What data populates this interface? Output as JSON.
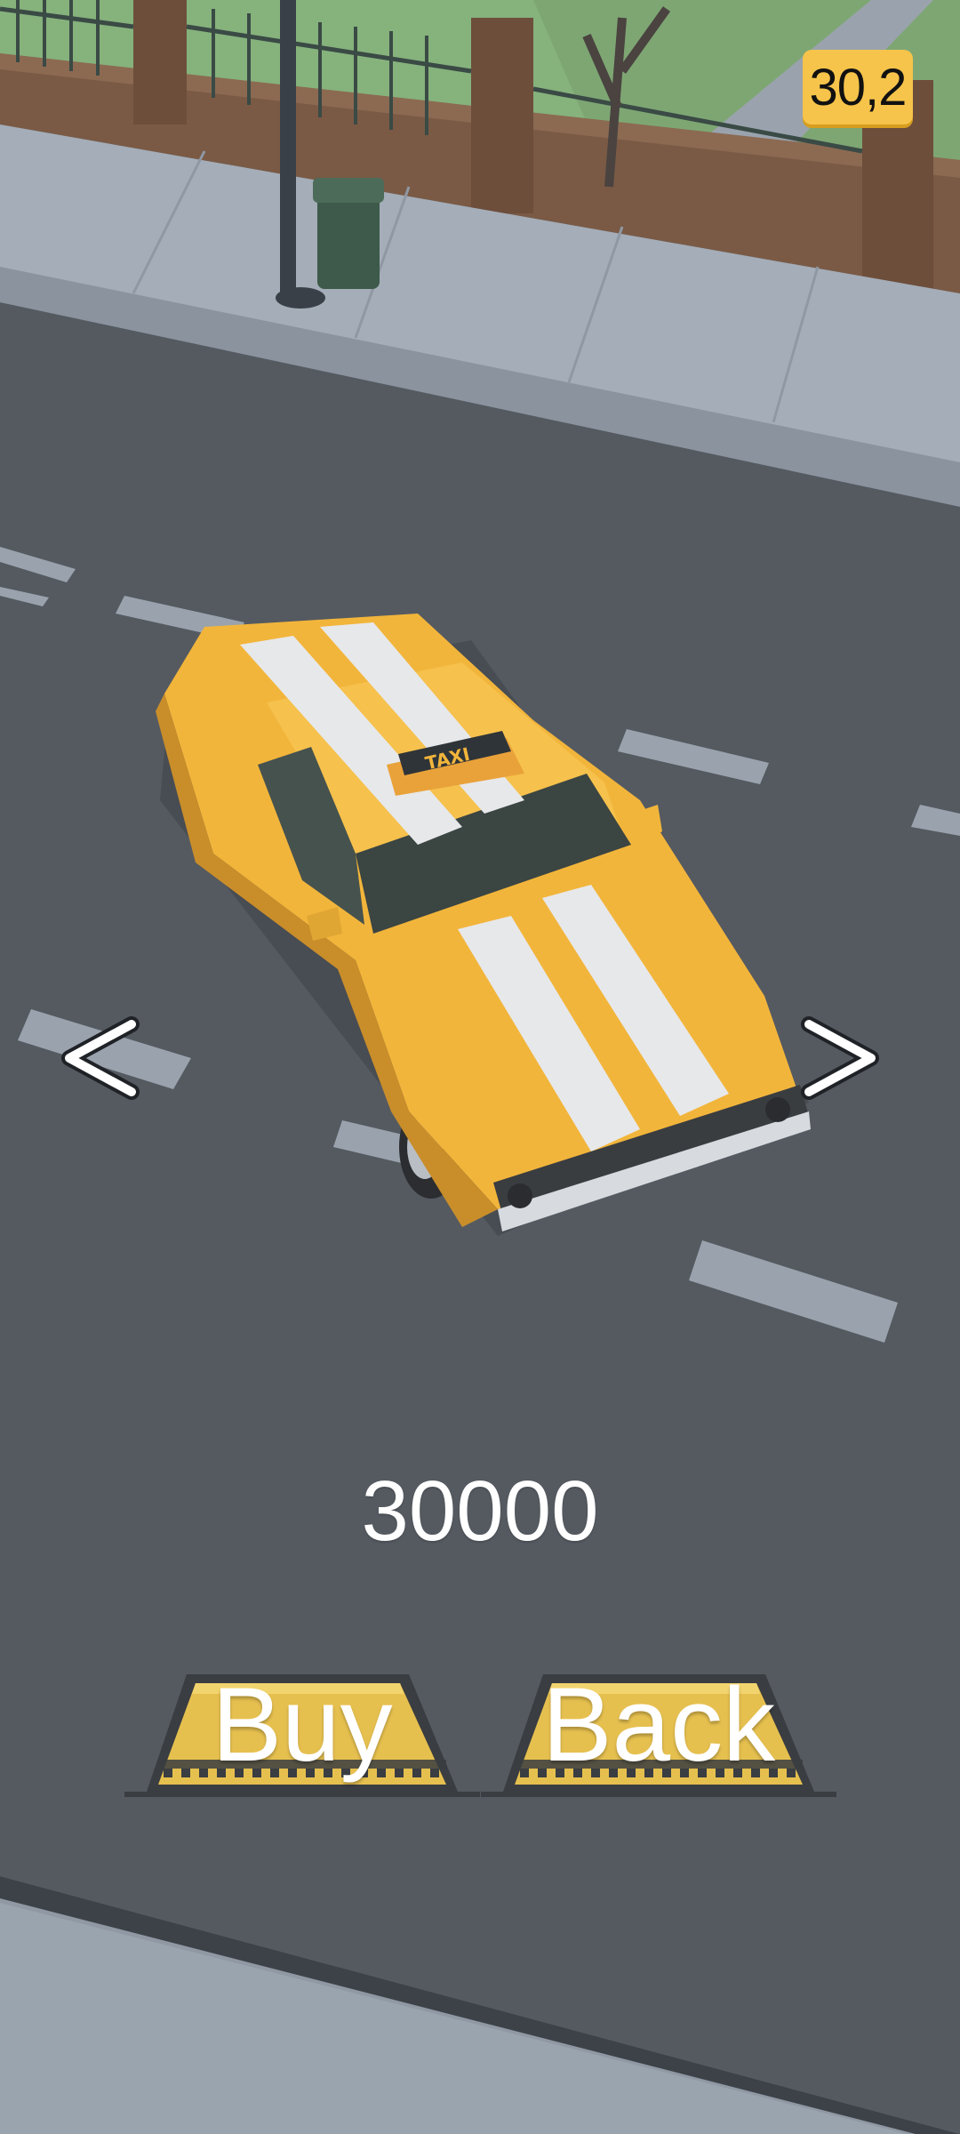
{
  "hud": {
    "coins": "30,2",
    "coin_color": "#f6c44a"
  },
  "shop": {
    "price": "30000",
    "prev_icon": "chevron-left-icon",
    "next_icon": "chevron-right-icon",
    "car": {
      "name_sign": "TAXI",
      "body_color": "#f2b53b",
      "stripe_color": "#e7e8ea"
    }
  },
  "buttons": {
    "buy_label": "Buy",
    "back_label": "Back",
    "button_color": "#e6c04f"
  }
}
